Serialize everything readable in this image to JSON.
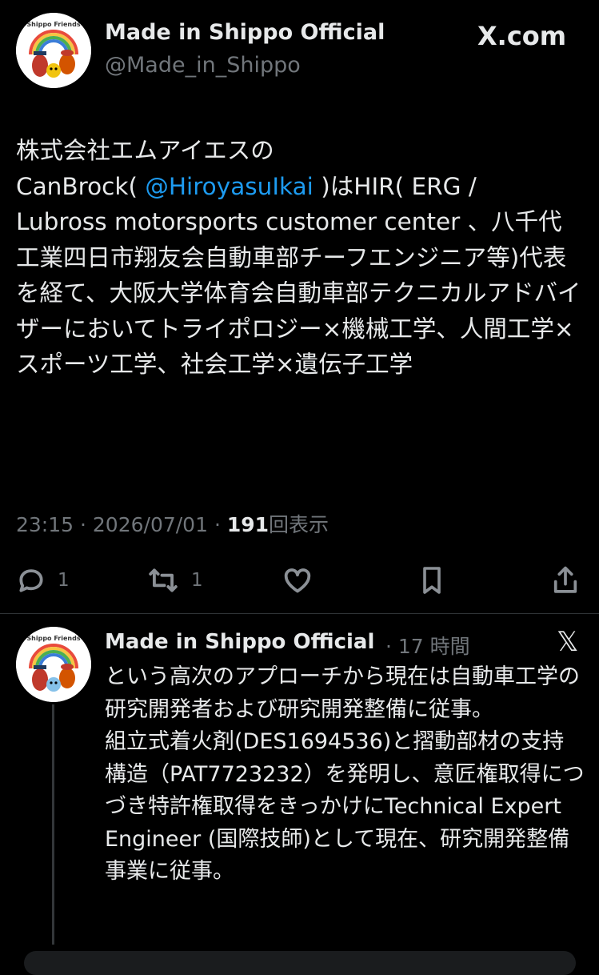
{
  "main_tweet": {
    "author_name": "Made in Shippo Official",
    "author_handle": "@Made_in_Shippo",
    "avatar_caption": "Shippo Friends",
    "site_label": "X.com",
    "text_line1": "株式会社エムアイエスの",
    "text_line2_pre": "CanBrock( ",
    "mention": "@HiroyasuIkai",
    "text_line2_post": " )はHIR( ERG /",
    "text_rest": "Lubross motorsports customer  center 、八千代工業四日市翔友会自動車部チーフエンジニア等)代表を経て、大阪大学体育会自動車部テクニカルアドバイザーにおいてトライポロジー×機械工学、人間工学×スポーツ工学、社会工学×遺伝子工学",
    "time": "23:15",
    "date": "2026/07/01",
    "separator": "·",
    "views_count": "191",
    "views_label": "回表示",
    "reply_count": "1",
    "repost_count": "1"
  },
  "reply_tweet": {
    "author_name": "Made in Shippo Official",
    "time_ago": "· 17 時間",
    "x_logo": "𝕏",
    "avatar_caption": "Shippo Friends",
    "text": "という高次のアプローチから現在は自動車工学の研究開発者および研究開発整備に従事。\n組立式着火剤(DES1694536)と摺動部材の支持構造（PAT7723232）を発明し、意匠権取得につづき特許権取得をきっかけにTechnical Expert Engineer (国際技師)として現在、研究開発整備事業に従事。"
  },
  "icons": [
    "reply-icon",
    "repost-icon",
    "like-icon",
    "bookmark-icon",
    "share-icon"
  ],
  "colors": {
    "background": "#000000",
    "text": "#e7e9ea",
    "muted": "#71767b",
    "link": "#1d9bf0"
  }
}
